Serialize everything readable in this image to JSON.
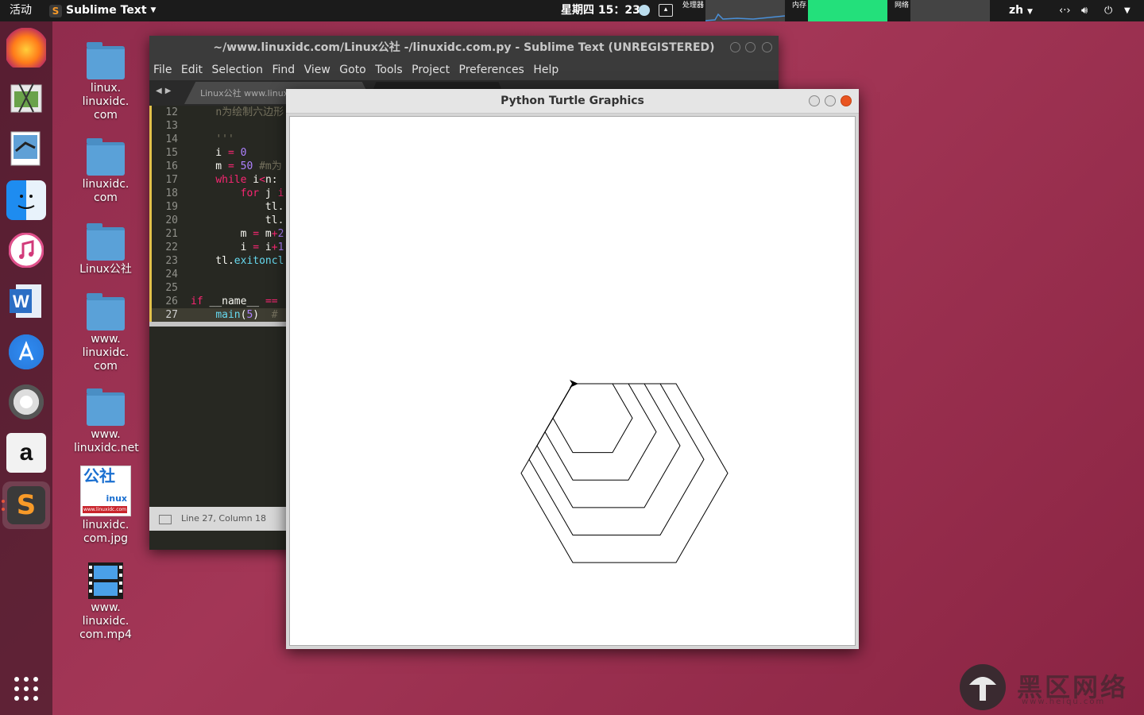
{
  "topbar": {
    "activities": "活动",
    "app_name": "Sublime Text",
    "clock": "星期四 15：23",
    "cpu_label": "处理器",
    "mem_label": "内存",
    "net_label": "网络",
    "lang": "zh"
  },
  "dock": {
    "items": [
      "firefox-icon",
      "screenshot-icon",
      "shotwell-icon",
      "finder-icon",
      "itunes-icon",
      "wps-writer-icon",
      "app-store-icon",
      "help-icon",
      "amazon-icon",
      "sublime-text-icon"
    ]
  },
  "desktop": {
    "icons": [
      {
        "label": "linux.\nlinuxidc.\ncom",
        "kind": "folder"
      },
      {
        "label": "linuxidc.\ncom",
        "kind": "folder"
      },
      {
        "label": "Linux公社",
        "kind": "folder"
      },
      {
        "label": "www.\nlinuxidc.\ncom",
        "kind": "folder"
      },
      {
        "label": "www.\nlinuxidc.net",
        "kind": "folder"
      },
      {
        "label": "linuxidc.\ncom.jpg",
        "kind": "image",
        "thumb_text": "公社",
        "thumb_sub": "inux",
        "thumb_url": "www.linuxidc.com"
      },
      {
        "label": "www.\nlinuxidc.\ncom.mp4",
        "kind": "video"
      }
    ]
  },
  "sublime": {
    "title": "~/www.linuxidc.com/Linux公社 -/linuxidc.com.py - Sublime Text (UNREGISTERED)",
    "menu": [
      "File",
      "Edit",
      "Selection",
      "Find",
      "View",
      "Goto",
      "Tools",
      "Project",
      "Preferences",
      "Help"
    ],
    "tab1": "Linux公社 www.linux",
    "line_numbers": [
      "12",
      "13",
      "14",
      "15",
      "16",
      "17",
      "18",
      "19",
      "20",
      "21",
      "22",
      "23",
      "24",
      "25",
      "26",
      "27"
    ],
    "status": "Line 27, Column 18"
  },
  "turtle": {
    "title": "Python Turtle Graphics",
    "hexagon_count": 5
  },
  "watermark": {
    "text": "黑区网络",
    "sub": "www.heiqu.com"
  },
  "colors": {
    "desktop": "#a33656",
    "editor_bg": "#272822",
    "keyword": "#f92672",
    "number": "#ae81ff",
    "comment": "#75715e",
    "function": "#66d9ef",
    "close_button": "#e95420"
  }
}
